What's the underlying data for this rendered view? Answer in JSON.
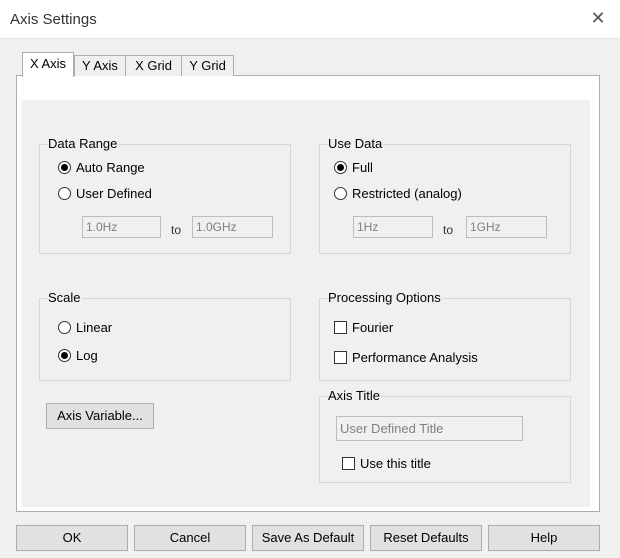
{
  "window": {
    "title": "Axis Settings",
    "close_glyph": "✕"
  },
  "tabs": [
    {
      "label": "X Axis",
      "active": true
    },
    {
      "label": "Y Axis",
      "active": false
    },
    {
      "label": "X Grid",
      "active": false
    },
    {
      "label": "Y Grid",
      "active": false
    }
  ],
  "data_range": {
    "label": "Data Range",
    "options": [
      {
        "label": "Auto Range",
        "selected": true
      },
      {
        "label": "User Defined",
        "selected": false
      }
    ],
    "from_value": "1.0Hz",
    "to_label": "to",
    "to_value": "1.0GHz"
  },
  "use_data": {
    "label": "Use Data",
    "options": [
      {
        "label": "Full",
        "selected": true
      },
      {
        "label": "Restricted (analog)",
        "selected": false
      }
    ],
    "from_value": "1Hz",
    "to_label": "to",
    "to_value": "1GHz"
  },
  "scale": {
    "label": "Scale",
    "options": [
      {
        "label": "Linear",
        "selected": false
      },
      {
        "label": "Log",
        "selected": true
      }
    ]
  },
  "processing": {
    "label": "Processing Options",
    "options": [
      {
        "label": "Fourier",
        "checked": false
      },
      {
        "label": "Performance Analysis",
        "checked": false
      }
    ]
  },
  "axis_variable_button": "Axis Variable...",
  "axis_title": {
    "label": "Axis Title",
    "value": "User Defined Title",
    "use_label": "Use this title",
    "use_checked": false
  },
  "footer": {
    "ok": "OK",
    "cancel": "Cancel",
    "save_default": "Save As Default",
    "reset_defaults": "Reset Defaults",
    "help": "Help"
  }
}
